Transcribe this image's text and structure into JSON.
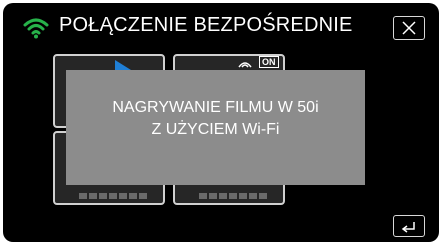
{
  "header": {
    "title": "POŁĄCZENIE BEZPOŚREDNIE",
    "wifi_icon": "wifi-icon",
    "close_icon": "close-icon"
  },
  "tiles": {
    "top_right_badge": "ON"
  },
  "dialog": {
    "line1": "NAGRYWANIE FILMU W 50i",
    "line2": "Z UŻYCIEM Wi-Fi"
  },
  "footer": {
    "back_icon": "back-arrow-icon"
  },
  "colors": {
    "screen_bg": "#000000",
    "dialog_bg": "#8c8c8c",
    "wifi_green": "#27b24a",
    "play_blue": "#1f7fd6"
  }
}
